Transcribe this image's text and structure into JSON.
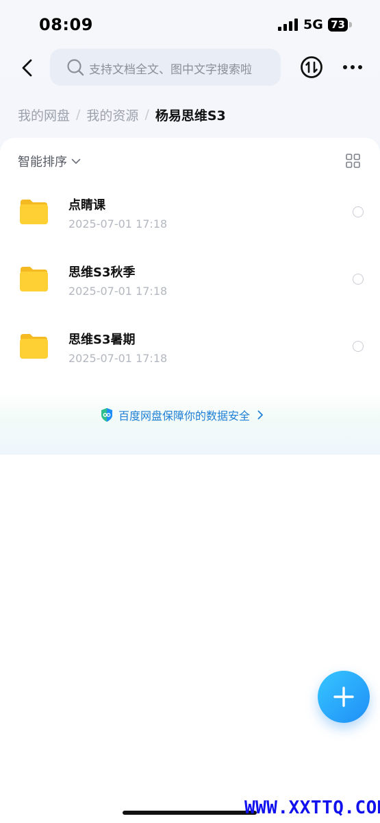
{
  "status_bar": {
    "time": "08:09",
    "network": "5G",
    "battery": "73"
  },
  "header": {
    "search_placeholder": "支持文档全文、图中文字搜索啦",
    "back_icon": "chevron-left-icon",
    "transfer_icon": "transfer-icon",
    "more_icon": "more-dots-icon"
  },
  "breadcrumb": {
    "items": [
      "我的网盘",
      "我的资源"
    ],
    "separator": "/",
    "current": "杨易思维S3"
  },
  "toolbar": {
    "sort_label": "智能排序",
    "view_icon": "grid-view-icon"
  },
  "files": [
    {
      "name": "点睛课",
      "date": "2025-07-01 17:18",
      "icon": "folder-icon"
    },
    {
      "name": "思维S3秋季",
      "date": "2025-07-01 17:18",
      "icon": "folder-icon"
    },
    {
      "name": "思维S3暑期",
      "date": "2025-07-01 17:18",
      "icon": "folder-icon"
    }
  ],
  "safety_banner": {
    "text": "百度网盘保障你的数据安全"
  },
  "fab": {
    "icon": "plus-icon"
  },
  "watermark": "WWW.XXTTQ.COM",
  "colors": {
    "accent": "#1f8ef7",
    "folder": "#ffd034",
    "safety_text": "#1f7fd6",
    "watermark": "#1111ee"
  }
}
